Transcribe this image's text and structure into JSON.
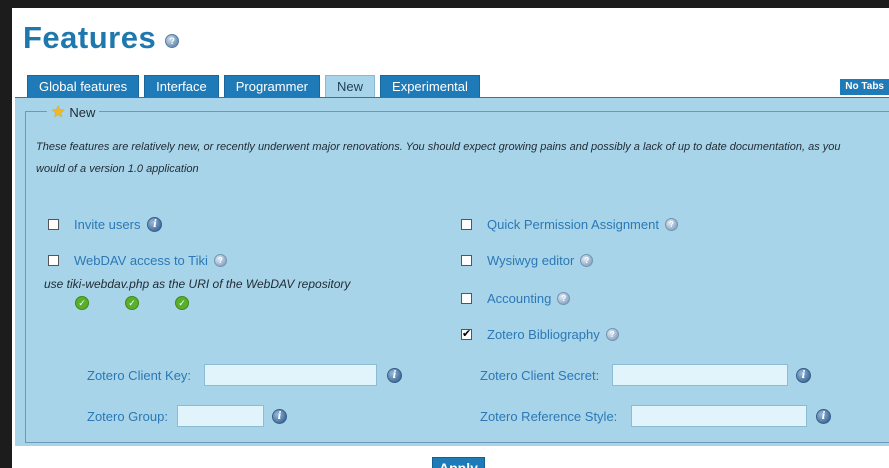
{
  "page": {
    "title": "Features"
  },
  "tabs": [
    {
      "label": "Global features"
    },
    {
      "label": "Interface"
    },
    {
      "label": "Programmer"
    },
    {
      "label": "New",
      "active": true
    },
    {
      "label": "Experimental"
    }
  ],
  "no_tabs_label": "No Tabs",
  "fieldset": {
    "legend": "New",
    "description": "These features are relatively new, or recently underwent major renovations. You should expect growing pains and possibly a lack of up to date documentation, as you would of a version 1.0 application"
  },
  "options": {
    "invite_users": {
      "label": "Invite users",
      "checked": false
    },
    "webdav": {
      "label": "WebDAV access to Tiki",
      "checked": false,
      "hint": "use tiki-webdav.php as the URI of the WebDAV repository"
    },
    "quick_permission": {
      "label": "Quick Permission Assignment",
      "checked": false
    },
    "wysiwyg": {
      "label": "Wysiwyg editor",
      "checked": false
    },
    "accounting": {
      "label": "Accounting",
      "checked": false
    },
    "zotero": {
      "label": "Zotero Bibliography",
      "checked": true
    }
  },
  "fields": {
    "client_key": {
      "label": "Zotero Client Key:",
      "value": ""
    },
    "client_secret": {
      "label": "Zotero Client Secret:",
      "value": ""
    },
    "group": {
      "label": "Zotero Group:",
      "value": ""
    },
    "reference_style": {
      "label": "Zotero Reference Style:",
      "value": ""
    }
  },
  "apply_label": "Apply",
  "colors": {
    "accent": "#1f7bb8",
    "panel": "#a8d4e9",
    "title": "#1f78ad"
  }
}
